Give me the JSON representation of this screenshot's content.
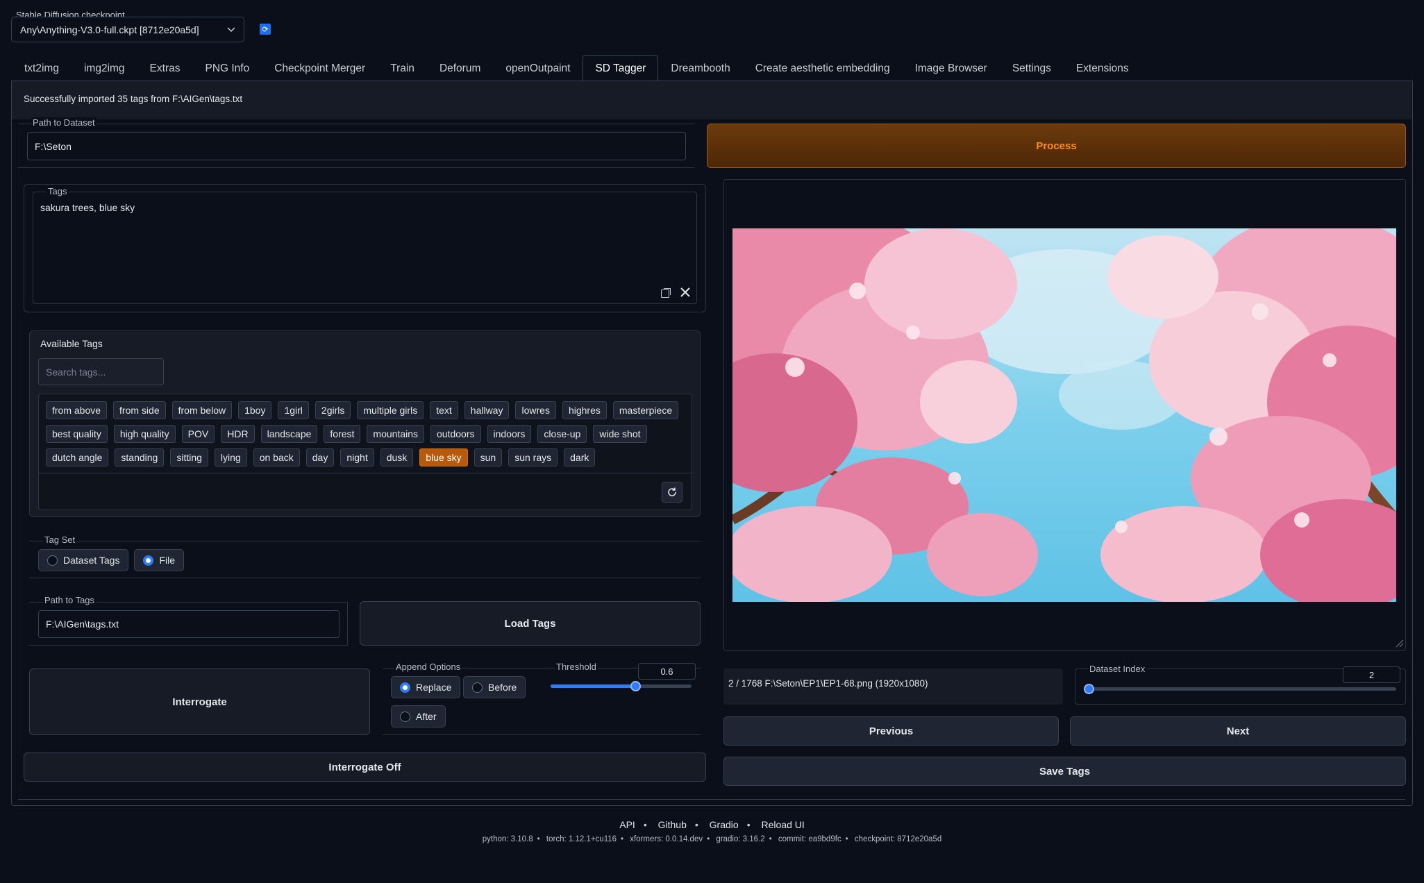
{
  "checkpoint": {
    "label": "Stable Diffusion checkpoint",
    "value": "Any\\Anything-V3.0-full.ckpt [8712e20a5d]",
    "refresh_icon": "refresh-icon"
  },
  "tabs": [
    {
      "label": "txt2img"
    },
    {
      "label": "img2img"
    },
    {
      "label": "Extras"
    },
    {
      "label": "PNG Info"
    },
    {
      "label": "Checkpoint Merger"
    },
    {
      "label": "Train"
    },
    {
      "label": "Deforum"
    },
    {
      "label": "openOutpaint"
    },
    {
      "label": "SD Tagger"
    },
    {
      "label": "Dreambooth"
    },
    {
      "label": "Create aesthetic embedding"
    },
    {
      "label": "Image Browser"
    },
    {
      "label": "Settings"
    },
    {
      "label": "Extensions"
    }
  ],
  "active_tab": "SD Tagger",
  "status": "Successfully imported 35 tags from F:\\AIGen\\tags.txt",
  "dataset_path": {
    "label": "Path to Dataset",
    "value": "F:\\Seton"
  },
  "process_label": "Process",
  "tags": {
    "label": "Tags",
    "value": "sakura trees, blue sky"
  },
  "available_tags": {
    "title": "Available Tags",
    "search_placeholder": "Search tags...",
    "rows": [
      [
        "from above",
        "from side",
        "from below",
        "1boy",
        "1girl",
        "2girls",
        "multiple girls",
        "text",
        "hallway",
        "lowres",
        "highres",
        "masterpiece"
      ],
      [
        "best quality",
        "high quality",
        "POV",
        "HDR",
        "landscape",
        "forest",
        "mountains",
        "outdoors",
        "indoors",
        "close-up",
        "wide shot"
      ],
      [
        "dutch angle",
        "standing",
        "sitting",
        "lying",
        "on back",
        "day",
        "night",
        "dusk",
        "blue sky",
        "sun",
        "sun rays",
        "dark"
      ]
    ],
    "selected": [
      "blue sky"
    ]
  },
  "tag_set": {
    "label": "Tag Set",
    "options": [
      "Dataset Tags",
      "File"
    ],
    "selected": "File"
  },
  "tags_path": {
    "label": "Path to Tags",
    "value": "F:\\AIGen\\tags.txt"
  },
  "load_tags_label": "Load Tags",
  "interrogate_label": "Interrogate",
  "append_options": {
    "label": "Append Options",
    "options": [
      "Replace",
      "Before",
      "After"
    ],
    "selected": "Replace"
  },
  "threshold": {
    "label": "Threshold",
    "value": "0.6",
    "fraction": 0.6
  },
  "interrogate_off_label": "Interrogate Off",
  "image_info": "2 / 1768 F:\\Seton\\EP1\\EP1-68.png (1920x1080)",
  "dataset_index": {
    "label": "Dataset Index",
    "value": "2",
    "fraction": 0.0
  },
  "previous_label": "Previous",
  "next_label": "Next",
  "save_tags_label": "Save Tags",
  "footer": {
    "links": [
      "API",
      "Github",
      "Gradio",
      "Reload UI"
    ],
    "versions": [
      "python: 3.10.8",
      "torch: 1.12.1+cu116",
      "xformers: 0.0.14.dev",
      "gradio: 3.16.2",
      "commit: ea9bd9fc",
      "checkpoint: 8712e20a5d"
    ]
  },
  "colors": {
    "accent": "#2f7cf6",
    "process": "#ff8c1a",
    "selected_tag": "#b85a0b"
  }
}
